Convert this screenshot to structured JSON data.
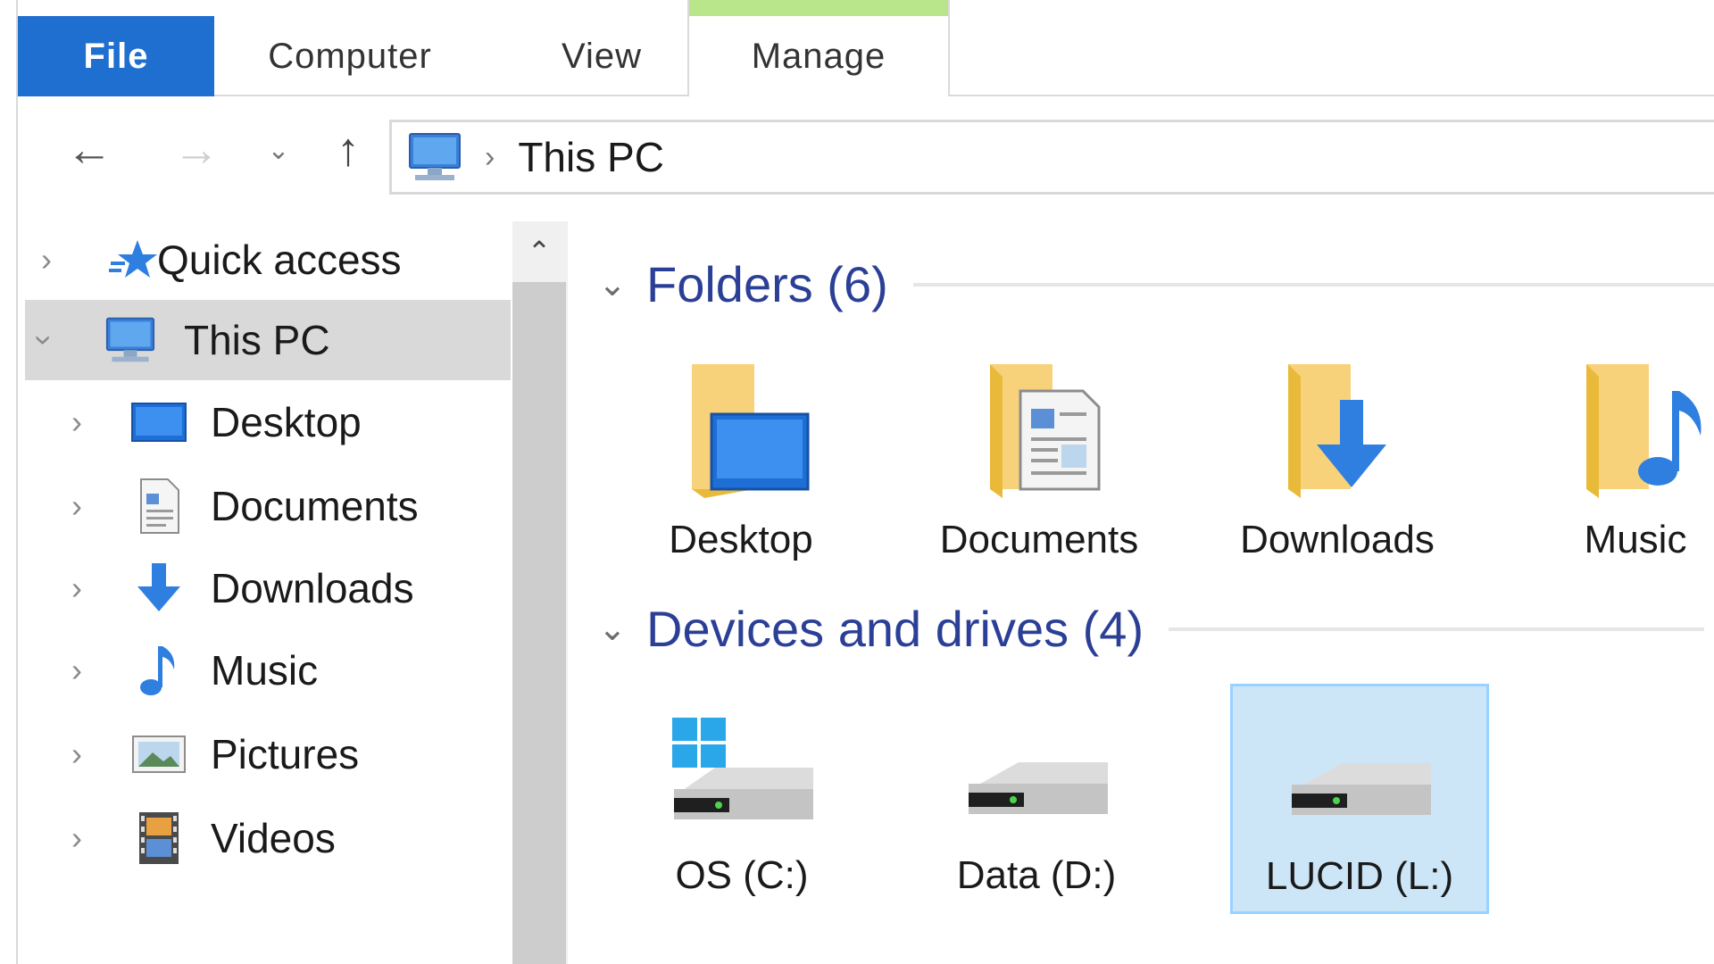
{
  "ribbon": {
    "tabs": [
      {
        "label": "File"
      },
      {
        "label": "Computer"
      },
      {
        "label": "View"
      },
      {
        "label": "Manage"
      }
    ]
  },
  "navigation": {
    "back_icon": "arrow-left-icon",
    "forward_icon": "arrow-right-icon",
    "recent_icon": "chevron-down-icon",
    "up_icon": "arrow-up-icon",
    "address": {
      "location_icon": "computer-icon",
      "crumb": "This PC"
    }
  },
  "sidebar": {
    "items": [
      {
        "label": "Quick access",
        "icon": "star-icon",
        "expanded": false
      },
      {
        "label": "This PC",
        "icon": "computer-icon",
        "expanded": true,
        "selected": true
      },
      {
        "label": "Desktop",
        "icon": "desktop-icon"
      },
      {
        "label": "Documents",
        "icon": "documents-icon"
      },
      {
        "label": "Downloads",
        "icon": "download-arrow-icon"
      },
      {
        "label": "Music",
        "icon": "music-note-icon"
      },
      {
        "label": "Pictures",
        "icon": "pictures-icon"
      },
      {
        "label": "Videos",
        "icon": "videos-icon"
      }
    ]
  },
  "content": {
    "folders_header": "Folders (6)",
    "folders": [
      {
        "label": "Desktop",
        "icon": "desktop-folder-icon"
      },
      {
        "label": "Documents",
        "icon": "documents-folder-icon"
      },
      {
        "label": "Downloads",
        "icon": "downloads-folder-icon"
      },
      {
        "label": "Music",
        "icon": "music-folder-icon"
      }
    ],
    "drives_header": "Devices and drives (4)",
    "drives": [
      {
        "label": "OS (C:)",
        "icon": "windows-drive-icon",
        "selected": false
      },
      {
        "label": "Data (D:)",
        "icon": "hard-drive-icon",
        "selected": false
      },
      {
        "label": "LUCID (L:)",
        "icon": "hard-drive-icon",
        "selected": true
      }
    ]
  },
  "colors": {
    "file_tab": "#1f6fd0",
    "manage_accent": "#b9e68a",
    "group_header": "#2b3f96",
    "selection_fill": "#cde6f7",
    "selection_border": "#99d1ff"
  }
}
